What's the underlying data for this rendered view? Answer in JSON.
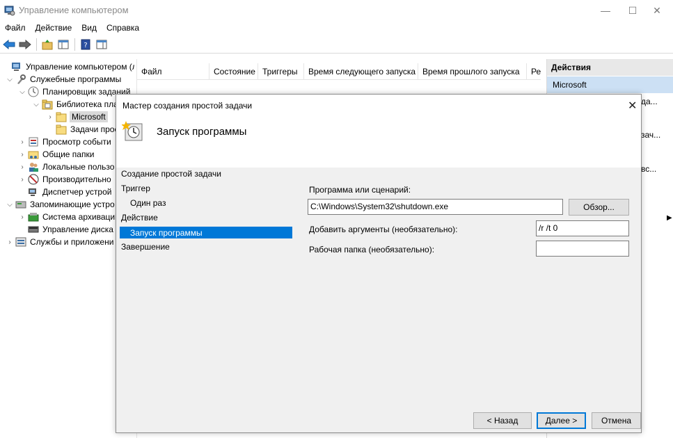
{
  "window": {
    "title": "Управление компьютером",
    "minimize": "—",
    "maximize": "☐",
    "close": "✕"
  },
  "menu": [
    "Файл",
    "Действие",
    "Вид",
    "Справка"
  ],
  "tree": {
    "root": "Управление компьютером (л",
    "system_tools": "Служебные программы",
    "task_scheduler": "Планировщик заданий",
    "library": "Библиотека пла",
    "microsoft": "Microsoft",
    "tasks": "Задачи прос",
    "event_viewer": "Просмотр событи",
    "shared_folders": "Общие папки",
    "local_users": "Локальные пользо",
    "performance": "Производительно",
    "device_manager": "Диспетчер устрой",
    "storage": "Запоминающие устро",
    "backup": "Система архивациі",
    "disk_mgmt": "Управление диска",
    "services": "Службы и приложени"
  },
  "columns": [
    "Файл",
    "Состояние",
    "Триггеры",
    "Время следующего запуска",
    "Время прошлого запуска",
    "Рез"
  ],
  "actions": {
    "header": "Действия",
    "selected": "Microsoft",
    "fragments": [
      "да...",
      "зач...",
      "вс..."
    ]
  },
  "wizard": {
    "title": "Мастер создания простой задачи",
    "close": "✕",
    "heading": "Запуск программы",
    "steps": [
      "Создание простой задачи",
      "Триггер",
      "Один раз",
      "Действие",
      "Запуск программы",
      "Завершение"
    ],
    "program_label": "Программа или сценарий:",
    "program_value": "C:\\Windows\\System32\\shutdown.exe",
    "browse": "Обзор...",
    "args_label": "Добавить аргументы (необязательно):",
    "args_value": "/r /t 0",
    "workdir_label": "Рабочая папка (необязательно):",
    "workdir_value": "",
    "back": "< Назад",
    "next": "Далее >",
    "cancel": "Отмена"
  }
}
